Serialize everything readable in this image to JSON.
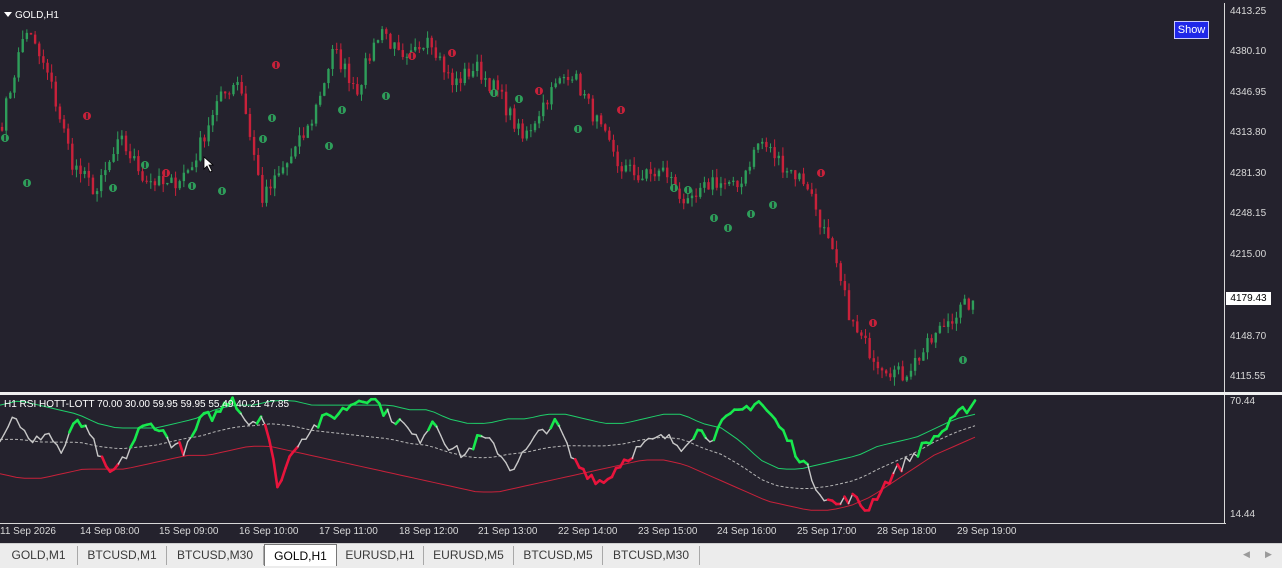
{
  "chart_window": {
    "title": "GOLD,H1",
    "show_button_label": "Show",
    "current_price_label": "4179.43",
    "colors": {
      "background": "#24222d",
      "bull": "#2e9e5a",
      "bear": "#c8213a",
      "text": "#d8d8d8",
      "show_button": "#1f27e8"
    },
    "icons": {
      "title_toggle": "triangle-down-icon",
      "cursor": "arrow-pointer-icon",
      "up_fractal": "up-arrow-marker-icon",
      "down_fractal": "down-arrow-marker-icon"
    }
  },
  "price_scale": [
    "4413.25",
    "4380.10",
    "4346.95",
    "4313.80",
    "4281.30",
    "4248.15",
    "4215.00",
    "4148.70",
    "4115.55"
  ],
  "indicator": {
    "title": "H1 RSI HOTT-LOTT  70.00 30.00 59.95 59.95 55.49 40.21 47.85",
    "scale": [
      "70.44",
      "14.44"
    ],
    "colors": {
      "rsi_up": "#18e84e",
      "rsi_down": "#e8143c",
      "rsi_neutral": "#c8c8c8",
      "hott": "#1fcf6a",
      "lott": "#c8213a",
      "mid": "#b5b5b5"
    }
  },
  "time_axis": [
    "11 Sep 2026",
    "14 Sep 08:00",
    "15 Sep 09:00",
    "16 Sep 10:00",
    "17 Sep 11:00",
    "18 Sep 12:00",
    "21 Sep 13:00",
    "22 Sep 14:00",
    "23 Sep 15:00",
    "24 Sep 16:00",
    "25 Sep 17:00",
    "28 Sep 18:00",
    "29 Sep 19:00"
  ],
  "tabs": [
    {
      "label": "GOLD,M1",
      "active": false
    },
    {
      "label": "BTCUSD,M1",
      "active": false
    },
    {
      "label": "BTCUSD,M30",
      "active": false
    },
    {
      "label": "GOLD,H1",
      "active": true
    },
    {
      "label": "EURUSD,H1",
      "active": false
    },
    {
      "label": "EURUSD,M5",
      "active": false
    },
    {
      "label": "BTCUSD,M5",
      "active": false
    },
    {
      "label": "BTCUSD,M30",
      "active": false
    }
  ],
  "scroll": {
    "left_icon": "chevron-left-icon",
    "right_icon": "chevron-right-icon"
  },
  "chart_data": {
    "type": "candlestick",
    "symbol": "GOLD",
    "timeframe": "H1",
    "ylim": [
      4105,
      4422
    ],
    "close_path": [
      {
        "t": "11 Sep 2026",
        "close": 4325
      },
      {
        "t": "11 Sep 2026",
        "close": 4402
      },
      {
        "t": "11 Sep 2026",
        "close": 4360
      },
      {
        "t": "14 Sep 08:00",
        "close": 4290
      },
      {
        "t": "14 Sep 08:00",
        "close": 4268
      },
      {
        "t": "14 Sep 08:00",
        "close": 4310
      },
      {
        "t": "15 Sep 09:00",
        "close": 4280
      },
      {
        "t": "15 Sep 09:00",
        "close": 4272
      },
      {
        "t": "15 Sep 09:00",
        "close": 4288
      },
      {
        "t": "16 Sep 10:00",
        "close": 4338
      },
      {
        "t": "16 Sep 10:00",
        "close": 4362
      },
      {
        "t": "16 Sep 10:00",
        "close": 4262
      },
      {
        "t": "16 Sep 10:00",
        "close": 4290
      },
      {
        "t": "17 Sep 11:00",
        "close": 4322
      },
      {
        "t": "17 Sep 11:00",
        "close": 4383
      },
      {
        "t": "17 Sep 11:00",
        "close": 4352
      },
      {
        "t": "18 Sep 12:00",
        "close": 4403
      },
      {
        "t": "18 Sep 12:00",
        "close": 4370
      },
      {
        "t": "18 Sep 12:00",
        "close": 4398
      },
      {
        "t": "21 Sep 13:00",
        "close": 4355
      },
      {
        "t": "21 Sep 13:00",
        "close": 4370
      },
      {
        "t": "21 Sep 13:00",
        "close": 4348
      },
      {
        "t": "21 Sep 13:00",
        "close": 4310
      },
      {
        "t": "22 Sep 14:00",
        "close": 4345
      },
      {
        "t": "22 Sep 14:00",
        "close": 4368
      },
      {
        "t": "22 Sep 14:00",
        "close": 4330
      },
      {
        "t": "23 Sep 15:00",
        "close": 4290
      },
      {
        "t": "23 Sep 15:00",
        "close": 4280
      },
      {
        "t": "23 Sep 15:00",
        "close": 4285
      },
      {
        "t": "24 Sep 16:00",
        "close": 4255
      },
      {
        "t": "24 Sep 16:00",
        "close": 4278
      },
      {
        "t": "24 Sep 16:00",
        "close": 4270
      },
      {
        "t": "25 Sep 17:00",
        "close": 4310
      },
      {
        "t": "25 Sep 17:00",
        "close": 4290
      },
      {
        "t": "25 Sep 17:00",
        "close": 4275
      },
      {
        "t": "25 Sep 17:00",
        "close": 4220
      },
      {
        "t": "28 Sep 18:00",
        "close": 4155
      },
      {
        "t": "28 Sep 18:00",
        "close": 4130
      },
      {
        "t": "28 Sep 18:00",
        "close": 4118
      },
      {
        "t": "29 Sep 19:00",
        "close": 4140
      },
      {
        "t": "29 Sep 19:00",
        "close": 4165
      },
      {
        "t": "29 Sep 19:00",
        "close": 4179.43
      }
    ],
    "indicator_series": {
      "ylim": [
        14.44,
        70.44
      ],
      "rsi": [
        52,
        62,
        48,
        55,
        45,
        60,
        50,
        35,
        42,
        55,
        58,
        50,
        46,
        60,
        62,
        70,
        58,
        62,
        30,
        48,
        55,
        60,
        63,
        68,
        70,
        62,
        58,
        50,
        60,
        48,
        44,
        52,
        48,
        38,
        46,
        55,
        58,
        42,
        36,
        32,
        40,
        46,
        50,
        52,
        48,
        55,
        52,
        60,
        64,
        68,
        60,
        50,
        40,
        28,
        22,
        26,
        20,
        30,
        38,
        44,
        50,
        55,
        62,
        68
      ],
      "hott": [
        66,
        68,
        66,
        64,
        62,
        58,
        56,
        56,
        56,
        58,
        60,
        64,
        66,
        66,
        68,
        68,
        66,
        66,
        66,
        66,
        66,
        64,
        64,
        60,
        58,
        58,
        60,
        60,
        62,
        62,
        60,
        58,
        58,
        60,
        62,
        62,
        58,
        56,
        50,
        42,
        38,
        38,
        40,
        42,
        44,
        48,
        50,
        52,
        56,
        60,
        62
      ],
      "lott": [
        36,
        34,
        34,
        36,
        38,
        38,
        38,
        40,
        42,
        44,
        44,
        46,
        48,
        48,
        46,
        44,
        42,
        40,
        38,
        36,
        34,
        32,
        30,
        28,
        28,
        30,
        32,
        34,
        36,
        38,
        40,
        42,
        42,
        40,
        36,
        32,
        28,
        24,
        22,
        20,
        20,
        22,
        26,
        32,
        38,
        44,
        48,
        52
      ]
    }
  }
}
